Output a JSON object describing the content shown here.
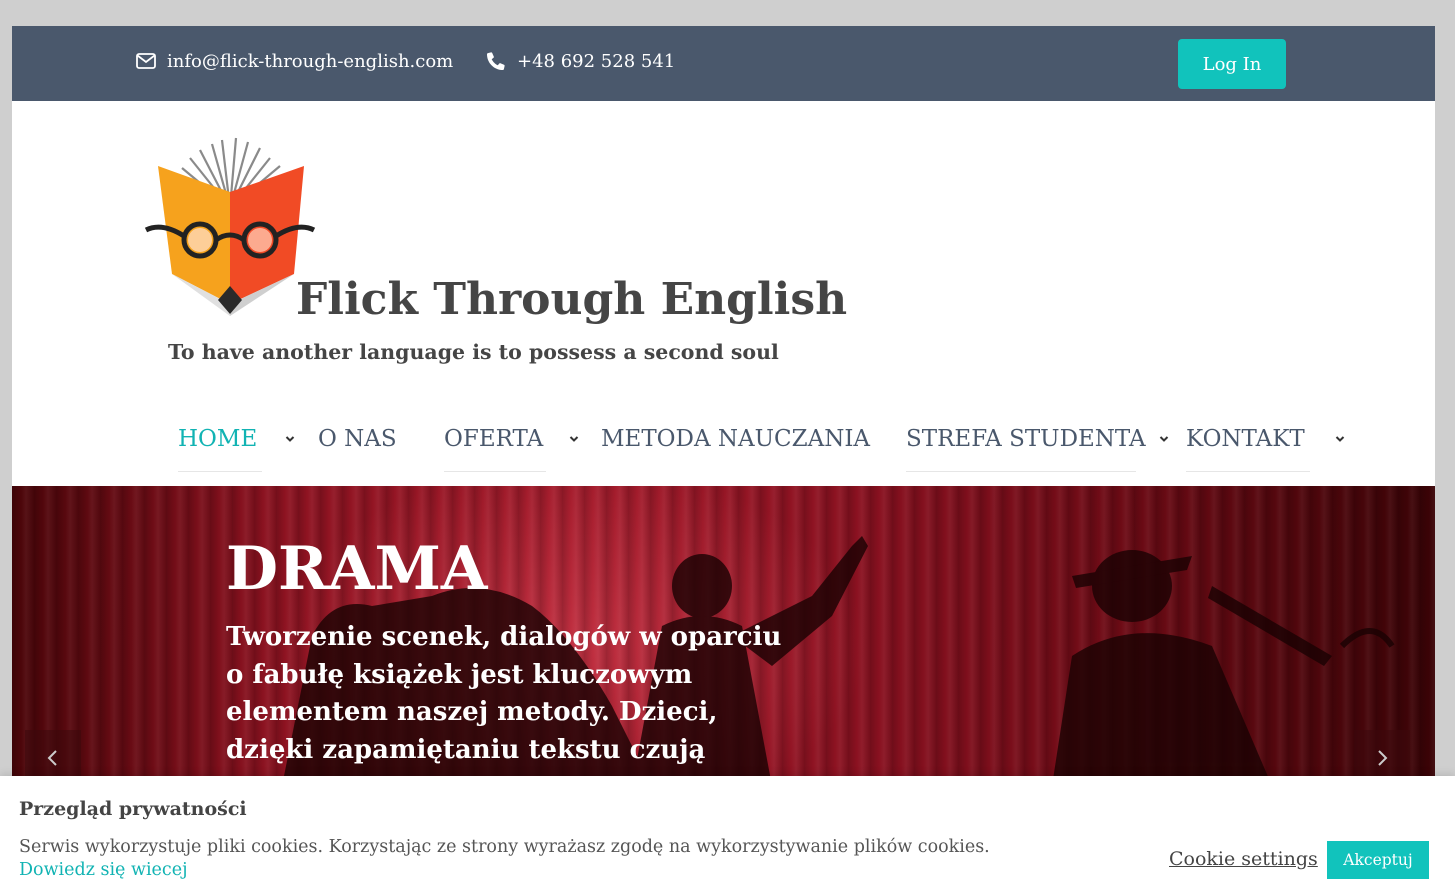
{
  "topbar": {
    "email": "info@flick-through-english.com",
    "phone": "+48 692 528 541",
    "login_label": "Log In",
    "email_icon": "envelope-icon",
    "phone_icon": "phone-icon"
  },
  "logo": {
    "title": "Flick Through English",
    "tagline": "To have another language is to possess a second soul"
  },
  "nav": {
    "items": [
      {
        "label": "HOME",
        "active": true,
        "has_dropdown": true
      },
      {
        "label": "O NAS",
        "active": false,
        "has_dropdown": false
      },
      {
        "label": "OFERTA",
        "active": false,
        "has_dropdown": true
      },
      {
        "label": "METODA NAUCZANIA",
        "active": false,
        "has_dropdown": false
      },
      {
        "label": "STREFA STUDENTA",
        "active": false,
        "has_dropdown": true
      },
      {
        "label": "KONTAKT",
        "active": false,
        "has_dropdown": true
      }
    ]
  },
  "hero": {
    "title": "DRAMA",
    "text": "Tworzenie scenek, dialogów w oparciu o fabułę książek jest kluczowym elementem naszej metody. Dzieci, dzięki zapamiętaniu tekstu czują",
    "prev_icon": "chevron-left-icon",
    "next_icon": "chevron-right-icon"
  },
  "cookie": {
    "title": "Przegląd prywatności",
    "text": "Serwis wykorzystuje pliki cookies. Korzystając ze strony wyrażasz zgodę na wykorzystywanie plików cookies.",
    "link": "Dowiedz się wiecej",
    "settings_label": "Cookie settings",
    "accept_label": "Akceptuj"
  },
  "colors": {
    "topbar": "#4a586c",
    "accent": "#11c3bc",
    "nav_text": "#4a586c",
    "nav_active": "#11b3b3"
  }
}
